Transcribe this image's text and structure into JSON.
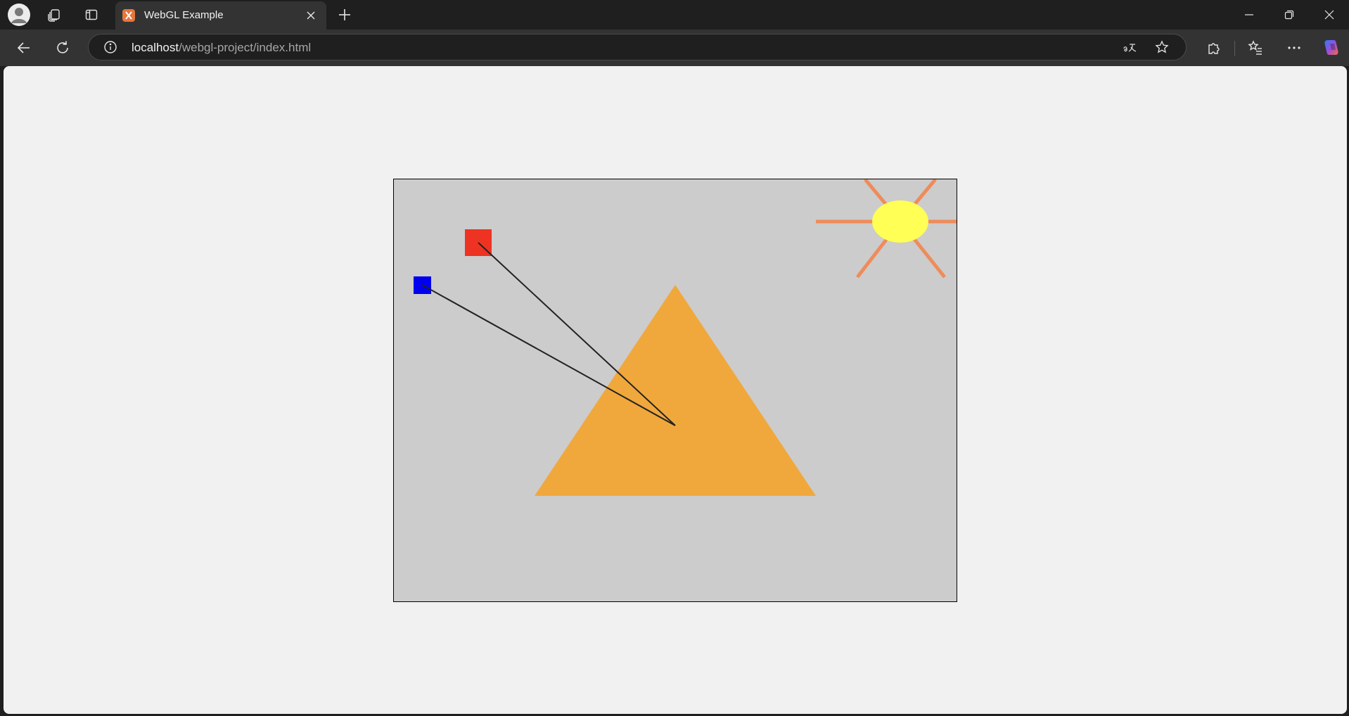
{
  "tab": {
    "title": "WebGL Example"
  },
  "address_bar": {
    "host": "localhost",
    "path": "/webgl-project/index.html"
  },
  "icons": {
    "profile": "profile-avatar-icon",
    "workspaces": "workspaces-icon",
    "tab_actions": "vertical-tabs-icon",
    "favicon": "xampp-favicon",
    "close_tab": "close-icon",
    "new_tab": "plus-icon",
    "minimize": "minimize-icon",
    "restore": "restore-icon",
    "close_window": "close-window-icon",
    "back": "back-arrow-icon",
    "refresh": "refresh-icon",
    "site_info": "info-icon",
    "read_aloud": "translate-icon",
    "favorite": "star-icon",
    "extensions": "puzzle-icon",
    "favorites": "favorites-list-icon",
    "menu": "more-icon",
    "copilot": "copilot-icon"
  },
  "colors": {
    "canvas_background": "#cccccc",
    "triangle": "#f0a83c",
    "red_square": "#ee3322",
    "blue_square": "#0000ee",
    "sun": "#ffff55",
    "sun_rays": "#ee8c5a",
    "line": "#222222"
  },
  "scene": {
    "shapes": [
      "triangle",
      "red-square",
      "blue-square",
      "sun",
      "sun-rays",
      "lines"
    ]
  }
}
